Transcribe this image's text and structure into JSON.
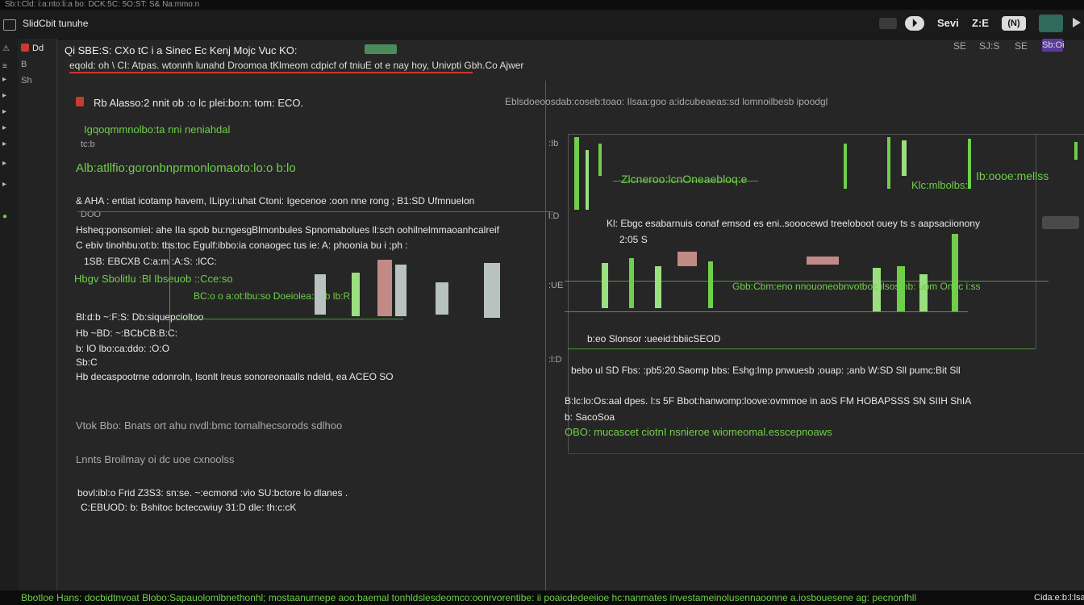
{
  "window": {
    "title": "Sb:I:Cld: i:a:nto:li:a bo: DCK:5C: 5O:ST: S& Na:mmo:n"
  },
  "toolbar": {
    "app_label": "SlidCbit tunuhe",
    "right_items": [
      "Sevi",
      "Z:E",
      "(N)"
    ],
    "right_sub": [
      "SE",
      "SJ:S",
      "SE",
      "Sb:Oi"
    ],
    "accent": "#5a3a9a"
  },
  "gutter": {
    "labels": [
      "Dd",
      "B",
      "Sh"
    ]
  },
  "editor": {
    "header_line": "Qi SBE:S: CXo tC i a Sinec Ec Kenj Mojc Vuc KO:",
    "subheader": "eqold: oh \\ CI: Atpas. wtonnh lunahd Droomoa tKlmeom cdpicf of tniuE ot e nay hoy, Univpti   Gbh.Co Ajwer",
    "lines": [
      "Rb Alasso:2 nnit ob :o lc plei:bo:n: tom: ECO.",
      "Igqoqmmnolbo:ta nni neniahdal",
      "tc:b",
      "Alb:atllfio:goronbnprmonlomaoto:lo:o b:lo",
      "& AHA : entiat icotamp havem, ILipy:i:uhat Ctoni: Igecenoe :oon nne rong ;   B1:SD Ufmnuelon",
      "DOO",
      "Hsheq:ponsomiei: ahe IIa spob bu:ngesgBlmonbules Spnomabolues    ll:sch oohilnelmmaoanhcalreif",
      "C ebiv tinohbu:ot:b: tbs:toc Egulf:ibbo:ia conaogec tus ie: A: phoonia  bu  i  ;ph :",
      "1SB: EBCXB   C:a:m   :A:S: :lCC:",
      "Hbgv Sbolitlu  :Bl  Ibseuob  ::Cce:so",
      "Bl:d:b  ~:F:S:   Db:siquepcioltoo",
      "Hb ~BD:   ~:BCbCB:B:C:",
      "b: lO lbo:ca:ddo: :O:O",
      "Sb:C",
      "Hb decaspootrne odonroln, lsonlt lreus sonoreonaalls ndeld, ea ACEO SO"
    ],
    "notes": [
      "Vtok Bbo: Bnats ort ahu  nvdl:bmc tomalhecsorods  sdlhoo",
      "Lnnts  Broilmay  oi dc  uoe cxnoolss",
      "bovl:ibl:o  Frid    Z3S3: sn:se.   ~:ecmond :vio  SU:bctore  lo  dlanes .",
      "C:EBUOD: b: Bshitoc bcteccwiuy 31:D dle: th:c:cK"
    ],
    "graph_label": "BC:o o a:ot:lbu:so   Doeiolea:hdb lb:R"
  },
  "chart_panel": {
    "left_labels": [
      ":Ib",
      "l:D",
      ":UE",
      ":l:D"
    ],
    "top_line": "Eblsdoeoosdab:coseb:toao:    Ilsaa:goo a:idcubeaeas:sd lomnoilbesb ipoodgl",
    "green_caption_1": "Zlcneroo:lcnOneaebloq:e",
    "green_caption_2": "Klc:mlbolbs:t",
    "green_caption_3": "Ib:oooe:mellss",
    "row_a": "Kl: Ebgc esabarnuis conaf  emsod es eni..sooocewd  treeloboot  ouey ts s aapsaciionony",
    "row_b": "2:05 S",
    "row_c": "Gbb:Cbm:eno  nnouoneobnvotboc ilsos nb:  uom Onoc i:ss",
    "row_d": "b:eo  Slonsor   :ueeid:bbiicSEOD",
    "row_e": "bebo  ul  SD   Fbs:  :pb5:20.Saomp  bbs: Eshg:lmp  pnwuesb   ;ouap: ;anb W:SD  Sll  pumc:Bit  Sll",
    "row_f": "B:lc:lo:Os:aal  dpes. l:s  5F  Bbot:hanwomp:loove:ovmmoe  in  aoS  FM  HOBAPSSS  SN  SIIH  ShIA",
    "row_g": "b:  SacoSoa",
    "row_h": "OBO:  mucascet ciotnI nsnieroe  wiomeomal.esscepnoaws"
  },
  "status": {
    "text": "Bbotloe Hans: docbidtnvoat Blobo:Sapauolomlbnethonhl;  mostaanurnepe aoo:baemal tonhldslesdeomco:oonrvorentibe:  ii poaicdedeeiioe  hc:nanmates  investameinolusennaoonne a.iosbouesene  ag: pecnonfhll",
    "right": "Cida:e:b:l:lsa"
  },
  "colors": {
    "accent_green": "#6fcf4a",
    "accent_red": "#c93a2e",
    "accent_purple": "#5a3a9a"
  }
}
